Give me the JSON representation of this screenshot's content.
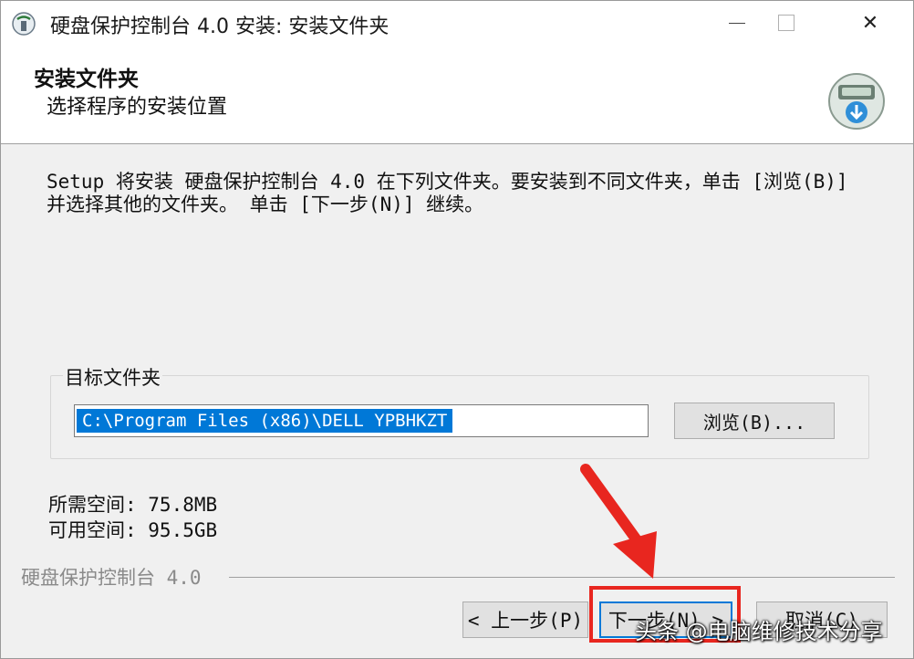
{
  "window": {
    "title": "硬盘保护控制台 4.0 安装: 安装文件夹",
    "close_glyph": "✕"
  },
  "header": {
    "title": "安装文件夹",
    "subtitle": "选择程序的安装位置",
    "icon": "installer-disk-icon"
  },
  "intro_text": "Setup 将安装 硬盘保护控制台 4.0 在下列文件夹。要安装到不同文件夹，单击 [浏览(B)] 并选择其他的文件夹。 单击 [下一步(N)] 继续。",
  "destination": {
    "group_label": "目标文件夹",
    "path": "C:\\Program Files (x86)\\DELL YPBHKZT",
    "browse_label": "浏览(B)..."
  },
  "space": {
    "required": "所需空间: 75.8MB",
    "available": "可用空间: 95.5GB"
  },
  "footer": {
    "brand": "硬盘保护控制台 4.0",
    "back_label": "< 上一步(P)",
    "next_label": "下一步(N) >",
    "cancel_label": "取消(C)"
  },
  "watermark": "头条 @电脑维修技术分享",
  "colors": {
    "accent": "#0078d7",
    "annotation": "#e8261f"
  }
}
